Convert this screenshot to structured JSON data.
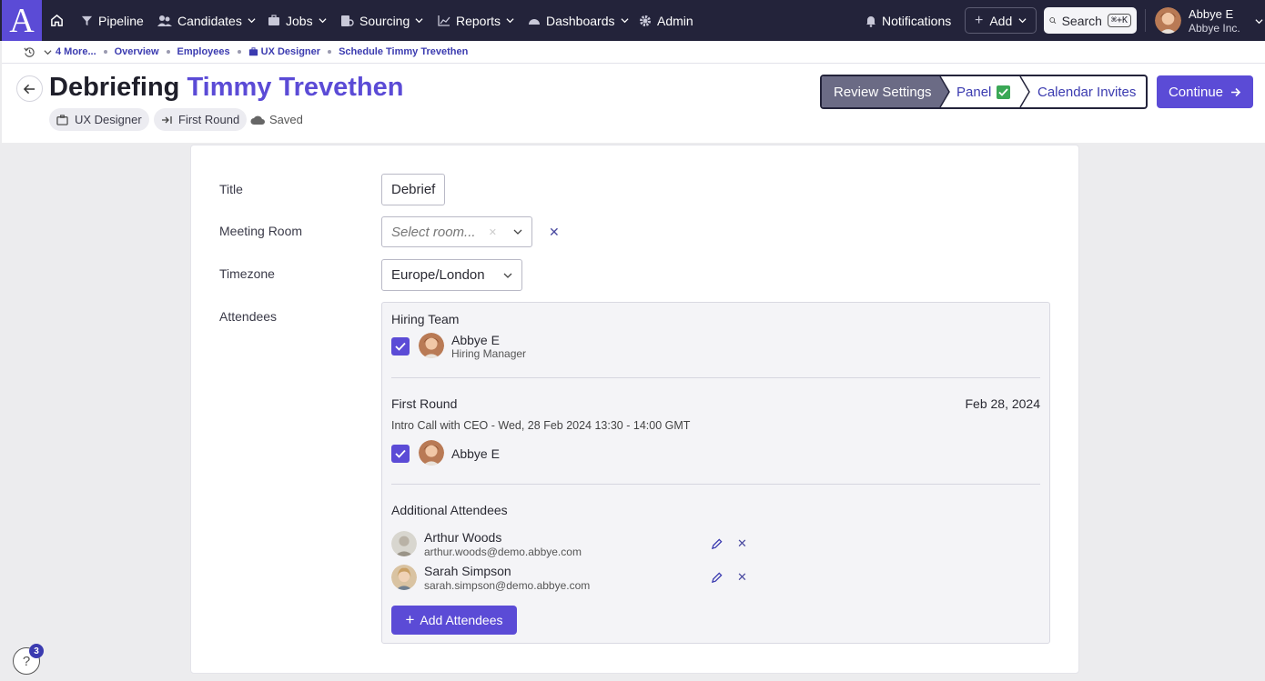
{
  "nav": {
    "items": [
      {
        "label": "Pipeline"
      },
      {
        "label": "Candidates"
      },
      {
        "label": "Jobs"
      },
      {
        "label": "Sourcing"
      },
      {
        "label": "Reports"
      },
      {
        "label": "Dashboards"
      },
      {
        "label": "Admin"
      }
    ],
    "notifications": "Notifications",
    "add": "Add",
    "search": "Search",
    "search_shortcut": "⌘+K",
    "user": {
      "name": "Abbye E",
      "org": "Abbye Inc."
    }
  },
  "breadcrumb": {
    "more": "4 More...",
    "items": [
      "Overview",
      "Employees",
      "UX Designer",
      "Schedule Timmy Trevethen"
    ]
  },
  "header": {
    "title_prefix": "Debriefing",
    "title_name": "Timmy Trevethen",
    "chips": {
      "job": "UX Designer",
      "stage": "First Round"
    },
    "saved": "Saved"
  },
  "stepper": {
    "steps": [
      "Review Settings",
      "Panel",
      "Calendar Invites"
    ],
    "active": "Review Settings"
  },
  "continue_label": "Continue",
  "form": {
    "title_label": "Title",
    "title_value": "Debrief",
    "room_label": "Meeting Room",
    "room_placeholder": "Select room...",
    "timezone_label": "Timezone",
    "timezone_value": "Europe/London",
    "attendees_label": "Attendees"
  },
  "attendees": {
    "hiring_team": {
      "title": "Hiring Team",
      "person": {
        "name": "Abbye E",
        "role": "Hiring Manager"
      }
    },
    "first_round": {
      "title": "First Round",
      "date": "Feb 28, 2024",
      "event": "Intro Call with CEO - Wed, 28 Feb 2024 13:30 - 14:00 GMT",
      "person": {
        "name": "Abbye E"
      }
    },
    "additional": {
      "title": "Additional Attendees",
      "people": [
        {
          "name": "Arthur Woods",
          "email": "arthur.woods@demo.abbye.com"
        },
        {
          "name": "Sarah Simpson",
          "email": "sarah.simpson@demo.abbye.com"
        }
      ],
      "add_label": "Add Attendees"
    }
  },
  "help": {
    "badge": "3"
  },
  "colors": {
    "accent": "#5b4bd6",
    "nav_bg": "#23233a",
    "link": "#3b3bb0"
  }
}
